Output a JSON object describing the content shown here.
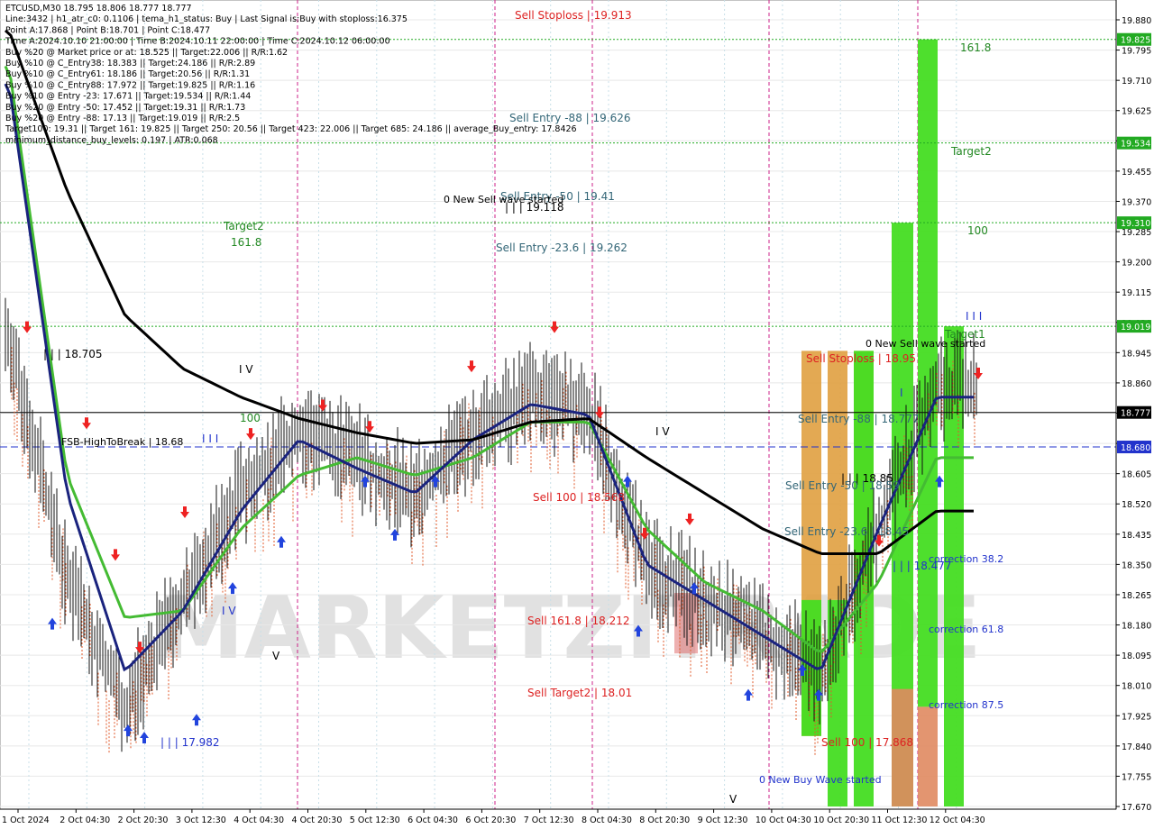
{
  "info_panel": [
    "ETCUSD,M30  18.795 18.806 18.777 18.777",
    "Line:3432 | h1_atr_c0: 0.1106 | tema_h1_status: Buy | Last Signal is:Buy with stoploss:16.375",
    "Point A:17.868 | Point B:18.701 | Point C:18.477",
    "Time A:2024.10.10 21:00:00 | Time B:2024.10.11 22:00:00 | Time C:2024.10.12 06:00:00",
    "Buy %20 @ Market price or at: 18.525 || Target:22.006 || R/R:1.62",
    "Buy %10 @ C_Entry38: 18.383 || Target:24.186 || R/R:2.89",
    "Buy %10 @ C_Entry61: 18.186 || Target:20.56 || R/R:1.31",
    "Buy %10 @ C_Entry88: 17.972 || Target:19.825 || R/R:1.16",
    "Buy %10 @ Entry -23: 17.671 || Target:19.534 || R/R:1.44",
    "Buy %20 @ Entry -50: 17.452 || Target:19.31 || R/R:1.73",
    "Buy %20 @ Entry -88: 17.13 || Target:19.019 || R/R:2.5",
    "Target100: 19.31 || Target 161: 19.825 || Target 250: 20.56 || Target 423: 22.006 || Target 685: 24.186 || average_Buy_entry: 17.8426",
    "minimum_distance_buy_levels: 0.197 | ATR:0.068"
  ],
  "watermark": "MARKETZITRADE",
  "y_axis_ticks": [
    "19.880",
    "19.795",
    "19.710",
    "19.625",
    "19.540",
    "19.455",
    "19.370",
    "19.285",
    "19.200",
    "19.115",
    "19.030",
    "18.945",
    "18.860",
    "18.775",
    "18.690",
    "18.605",
    "18.520",
    "18.435",
    "18.350",
    "18.265",
    "18.180",
    "18.095",
    "18.010",
    "17.925",
    "17.840",
    "17.755",
    "17.670"
  ],
  "x_axis_ticks": [
    "1 Oct 2024",
    "2 Oct 04:30",
    "2 Oct 20:30",
    "3 Oct 12:30",
    "4 Oct 04:30",
    "4 Oct 20:30",
    "5 Oct 12:30",
    "6 Oct 04:30",
    "6 Oct 20:30",
    "7 Oct 12:30",
    "8 Oct 04:30",
    "8 Oct 20:30",
    "9 Oct 12:30",
    "10 Oct 04:30",
    "10 Oct 20:30",
    "11 Oct 12:30",
    "12 Oct 04:30"
  ],
  "price_boxes": [
    {
      "label": "19.825",
      "color": "#22aa22"
    },
    {
      "label": "19.534",
      "color": "#22aa22"
    },
    {
      "label": "19.310",
      "color": "#22aa22"
    },
    {
      "label": "19.019",
      "color": "#22aa22"
    },
    {
      "label": "18.777",
      "color": "#000000"
    },
    {
      "label": "18.680",
      "color": "#2233cc"
    }
  ],
  "annotations": [
    {
      "text": "Sell Stoploss | 19.913",
      "color": "#dd2222"
    },
    {
      "text": "Sell Entry -88 | 19.626",
      "color": "#336677"
    },
    {
      "text": "Sell Entry -50 | 19.41",
      "color": "#336677"
    },
    {
      "text": "0 New Sell wave started",
      "color": "#000000"
    },
    {
      "text": "| | | 19.118",
      "color": "#000000"
    },
    {
      "text": "Sell Entry -23.6 | 19.262",
      "color": "#336677"
    },
    {
      "text": "Target2",
      "color": "#228822"
    },
    {
      "text": "161.8",
      "color": "#228822"
    },
    {
      "text": "| | | 18.705",
      "color": "#000000"
    },
    {
      "text": "I V",
      "color": "#000000"
    },
    {
      "text": "100",
      "color": "#228822"
    },
    {
      "text": "I I I",
      "color": "#2233cc"
    },
    {
      "text": "FSB-HighToBreak | 18.68",
      "color": "#000000"
    },
    {
      "text": "I V",
      "color": "#2233cc"
    },
    {
      "text": "V",
      "color": "#000000"
    },
    {
      "text": "| | | 17.982",
      "color": "#2233cc"
    },
    {
      "text": "Sell 100 | 18.568",
      "color": "#dd2222"
    },
    {
      "text": "Sell 161.8 | 18.212",
      "color": "#dd2222"
    },
    {
      "text": "Sell Target2 | 18.01",
      "color": "#dd2222"
    },
    {
      "text": "I V",
      "color": "#000000"
    },
    {
      "text": "V",
      "color": "#000000"
    },
    {
      "text": "161.8",
      "color": "#228822"
    },
    {
      "text": "Target2",
      "color": "#228822"
    },
    {
      "text": "100",
      "color": "#228822"
    },
    {
      "text": "I I I",
      "color": "#2233cc"
    },
    {
      "text": "Target1",
      "color": "#228822"
    },
    {
      "text": "0 New Sell wave started",
      "color": "#000000"
    },
    {
      "text": "Sell Stoploss | 18.95",
      "color": "#dd2222"
    },
    {
      "text": "I",
      "color": "#2233cc"
    },
    {
      "text": "Sell Entry -88 | 18.777",
      "color": "#336677"
    },
    {
      "text": "| | | 18.85",
      "color": "#000000"
    },
    {
      "text": "Sell Entry -50 | 18.59",
      "color": "#336677"
    },
    {
      "text": "Sell Entry -23.6 | 18.45",
      "color": "#336677"
    },
    {
      "text": "| | | 18.477",
      "color": "#2233cc"
    },
    {
      "text": "correction 38.2",
      "color": "#2233cc"
    },
    {
      "text": "correction 61.8",
      "color": "#2233cc"
    },
    {
      "text": "correction 87.5",
      "color": "#2233cc"
    },
    {
      "text": "Sell 100 | 17.868",
      "color": "#dd2222"
    },
    {
      "text": "0 New Buy Wave started",
      "color": "#2233cc"
    }
  ],
  "chart_data": {
    "type": "candlestick",
    "symbol": "ETCUSD",
    "timeframe": "M30",
    "ylim": [
      17.67,
      19.88
    ],
    "x": [
      "1 Oct 2024",
      "2 Oct 04:30",
      "2 Oct 20:30",
      "3 Oct 12:30",
      "4 Oct 04:30",
      "4 Oct 20:30",
      "5 Oct 12:30",
      "6 Oct 04:30",
      "6 Oct 20:30",
      "7 Oct 12:30",
      "8 Oct 04:30",
      "8 Oct 20:30",
      "9 Oct 12:30",
      "10 Oct 04:30",
      "10 Oct 20:30",
      "11 Oct 12:30",
      "12 Oct 04:30"
    ],
    "close": [
      19.0,
      18.3,
      17.95,
      18.25,
      18.55,
      18.72,
      18.65,
      18.55,
      18.72,
      18.82,
      18.78,
      18.35,
      18.25,
      18.15,
      18.05,
      18.45,
      18.85
    ],
    "series": [
      {
        "name": "green MA",
        "color": "#44bb33",
        "values": [
          19.75,
          18.6,
          18.2,
          18.22,
          18.45,
          18.6,
          18.65,
          18.6,
          18.65,
          18.75,
          18.75,
          18.45,
          18.3,
          18.22,
          18.1,
          18.3,
          18.65
        ]
      },
      {
        "name": "navy MA",
        "color": "#1a237e",
        "values": [
          19.7,
          18.55,
          18.05,
          18.22,
          18.5,
          18.7,
          18.62,
          18.55,
          18.7,
          18.8,
          18.77,
          18.35,
          18.25,
          18.15,
          18.05,
          18.45,
          18.82
        ]
      },
      {
        "name": "black MA",
        "color": "#000000",
        "values": [
          19.85,
          19.4,
          19.05,
          18.9,
          18.82,
          18.76,
          18.72,
          18.69,
          18.7,
          18.75,
          18.76,
          18.65,
          18.55,
          18.45,
          18.38,
          18.38,
          18.5
        ]
      }
    ],
    "levels": [
      {
        "value": 19.825,
        "color": "#22aa22",
        "style": "dotted"
      },
      {
        "value": 19.534,
        "color": "#22aa22",
        "style": "dotted"
      },
      {
        "value": 19.31,
        "color": "#22aa22",
        "style": "dotted"
      },
      {
        "value": 19.019,
        "color": "#22aa22",
        "style": "dotted"
      },
      {
        "value": 18.777,
        "color": "#000000",
        "style": "solid"
      },
      {
        "value": 18.68,
        "color": "#2233cc",
        "style": "dashed"
      }
    ],
    "vertical_lines": [
      {
        "at": "4 Oct 20:30",
        "color": "#cc2288"
      },
      {
        "at": "6 Oct 20:30",
        "color": "#cc2288"
      },
      {
        "at": "8 Oct 04:30",
        "color": "#cc2288"
      },
      {
        "at": "10 Oct 04:30",
        "color": "#cc2288"
      },
      {
        "at": "11 Oct 20:30",
        "color": "#cc2288"
      }
    ]
  }
}
